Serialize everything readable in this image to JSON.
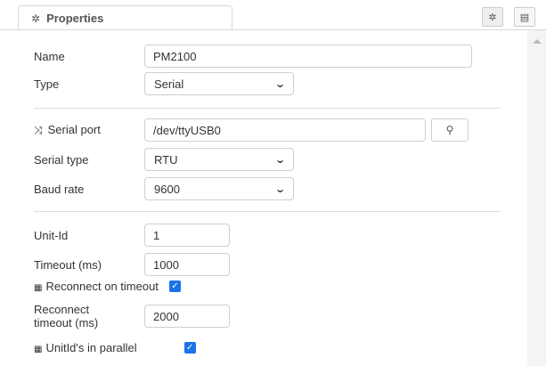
{
  "tab": {
    "label": "Properties"
  },
  "fields": {
    "name": {
      "label": "Name",
      "value": "PM2100"
    },
    "type": {
      "label": "Type",
      "value": "Serial"
    },
    "serial_port": {
      "label": "Serial port",
      "value": "/dev/ttyUSB0"
    },
    "serial_type": {
      "label": "Serial type",
      "value": "RTU"
    },
    "baud_rate": {
      "label": "Baud rate",
      "value": "9600"
    },
    "unit_id": {
      "label": "Unit-Id",
      "value": "1"
    },
    "timeout": {
      "label": "Timeout (ms)",
      "value": "1000"
    },
    "reconnect_on_timeout": {
      "label": "Reconnect on timeout",
      "checked": true
    },
    "reconnect_timeout": {
      "label_line1": "Reconnect",
      "label_line2": "timeout (ms)",
      "value": "2000"
    },
    "unitids_parallel": {
      "label": "UnitId's in parallel",
      "checked": true
    }
  },
  "icons": {
    "tab": "gear-icon",
    "toolbar_left": "gear-icon",
    "toolbar_right": "document-icon",
    "serial_port": "shuffle-icon",
    "search": "search-icon",
    "dropdown": "chevron-down-icon",
    "checkbox_row": "grid-icon"
  },
  "colors": {
    "checkbox": "#1a73e8"
  }
}
